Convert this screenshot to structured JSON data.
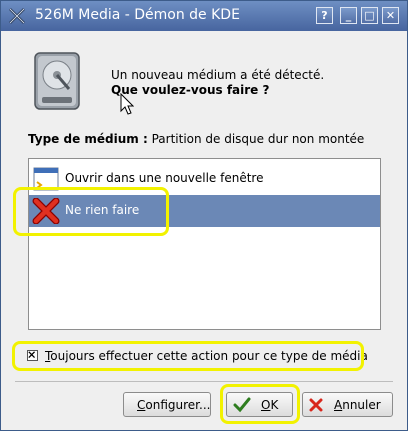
{
  "window": {
    "title": "526M Media - Démon de KDE",
    "buttons": {
      "help": "?",
      "minimize": "_",
      "maximize": "□",
      "close": "✕"
    }
  },
  "message": {
    "line1": "Un nouveau médium a été détecté.",
    "line2": "Que voulez-vous faire ?"
  },
  "medium_type": {
    "label": "Type de médium :",
    "value": "Partition de disque dur non montée"
  },
  "actions": [
    {
      "label": "Ouvrir dans une nouvelle fenêtre",
      "icon": "new-window-icon",
      "selected": false
    },
    {
      "label": "Ne rien faire",
      "icon": "red-x-icon",
      "selected": true
    }
  ],
  "always_checkbox": {
    "label_first": "T",
    "label_rest": "oujours effectuer cette action pour ce type de média",
    "checked": true
  },
  "buttons": {
    "configure_first": "C",
    "configure_rest": "onfigurer...",
    "ok_first": "O",
    "ok_rest": "K",
    "cancel_first": "A",
    "cancel_rest": "nnuler"
  },
  "colors": {
    "title_bar": "#47659f",
    "selection": "#6b88b6",
    "highlight": "#f2f200"
  }
}
